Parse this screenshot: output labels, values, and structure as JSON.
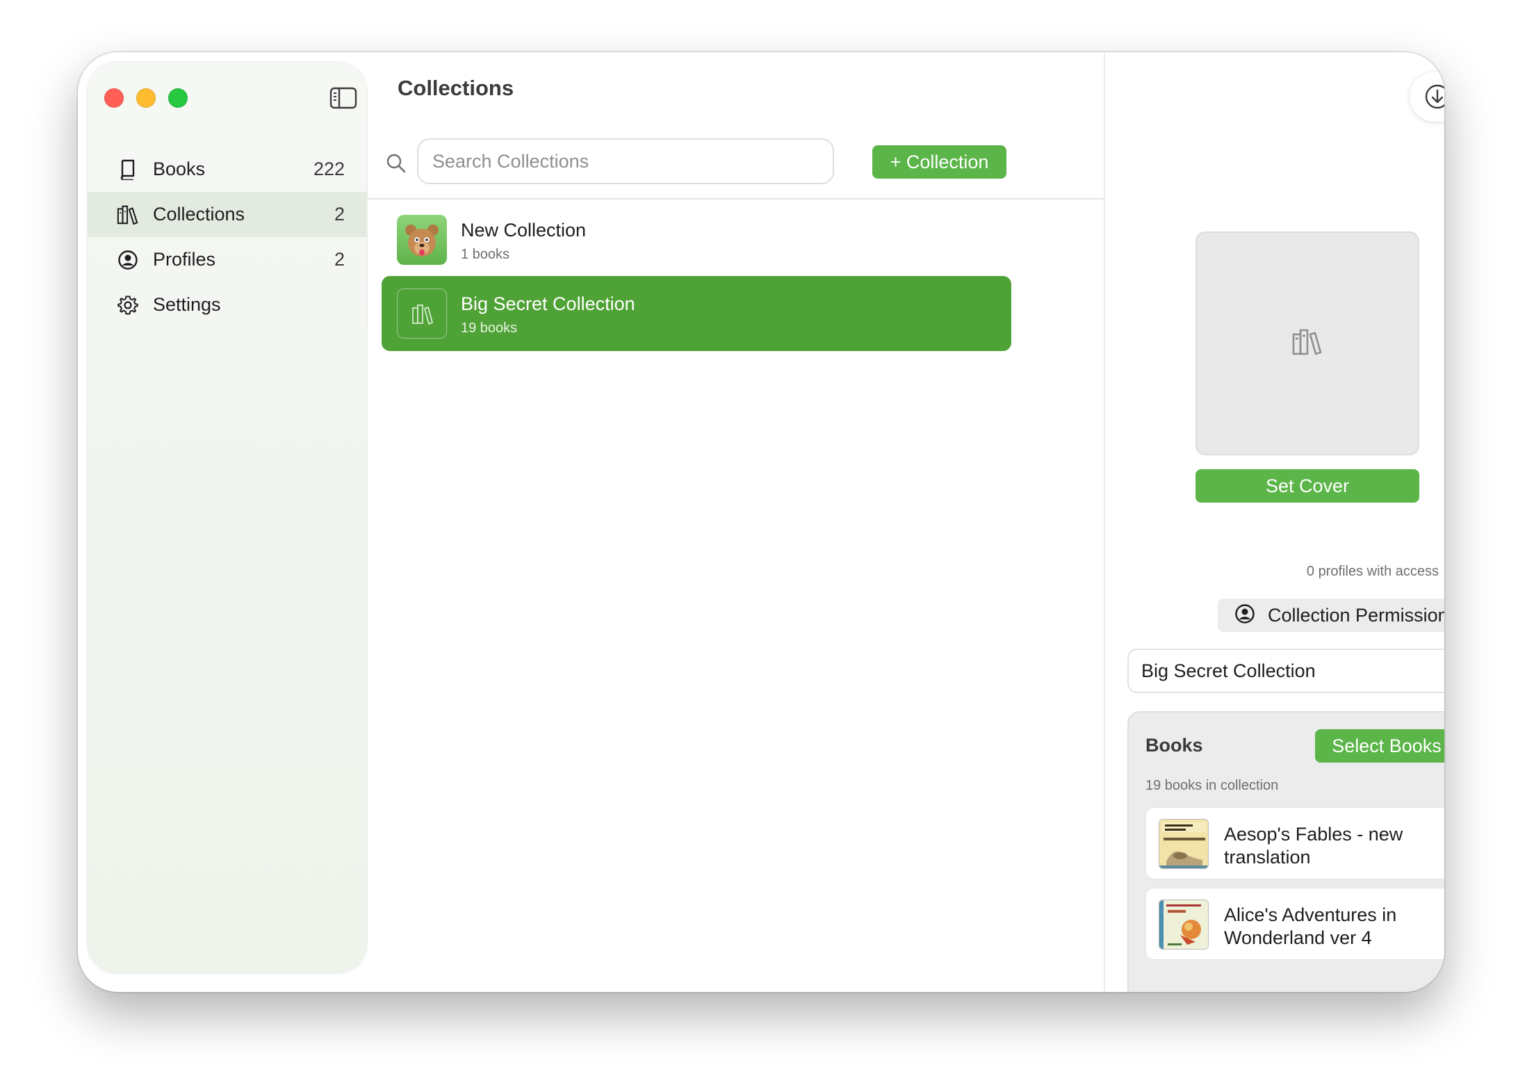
{
  "sidebar": {
    "items": [
      {
        "label": "Books",
        "count": "222",
        "icon": "book-icon"
      },
      {
        "label": "Collections",
        "count": "2",
        "icon": "collections-icon"
      },
      {
        "label": "Profiles",
        "count": "2",
        "icon": "profile-icon"
      },
      {
        "label": "Settings",
        "count": "",
        "icon": "gear-icon"
      }
    ]
  },
  "main": {
    "title": "Collections",
    "search": {
      "placeholder": "Search Collections",
      "value": ""
    },
    "add_button": "+ Collection",
    "collections": [
      {
        "title": "New Collection",
        "subtitle": "1 books",
        "thumb_icon": "bear-icon"
      },
      {
        "title": "Big Secret Collection",
        "subtitle": "19 books",
        "thumb_icon": "collections-icon"
      }
    ]
  },
  "detail": {
    "set_cover": "Set Cover",
    "profiles_access": "0 profiles with access",
    "permissions_button": "Collection Permissions",
    "name_value": "Big Secret Collection",
    "books": {
      "heading": "Books",
      "select_button": "Select Books",
      "count_text": "19 books in collection",
      "items": [
        {
          "title": "Aesop's Fables - new translation"
        },
        {
          "title": "Alice's Adventures in Wonderland ver 4"
        }
      ]
    }
  },
  "colors": {
    "accent": "#5bb548",
    "selection": "#4fa236",
    "sidebar_active": "#e3ebe0"
  }
}
